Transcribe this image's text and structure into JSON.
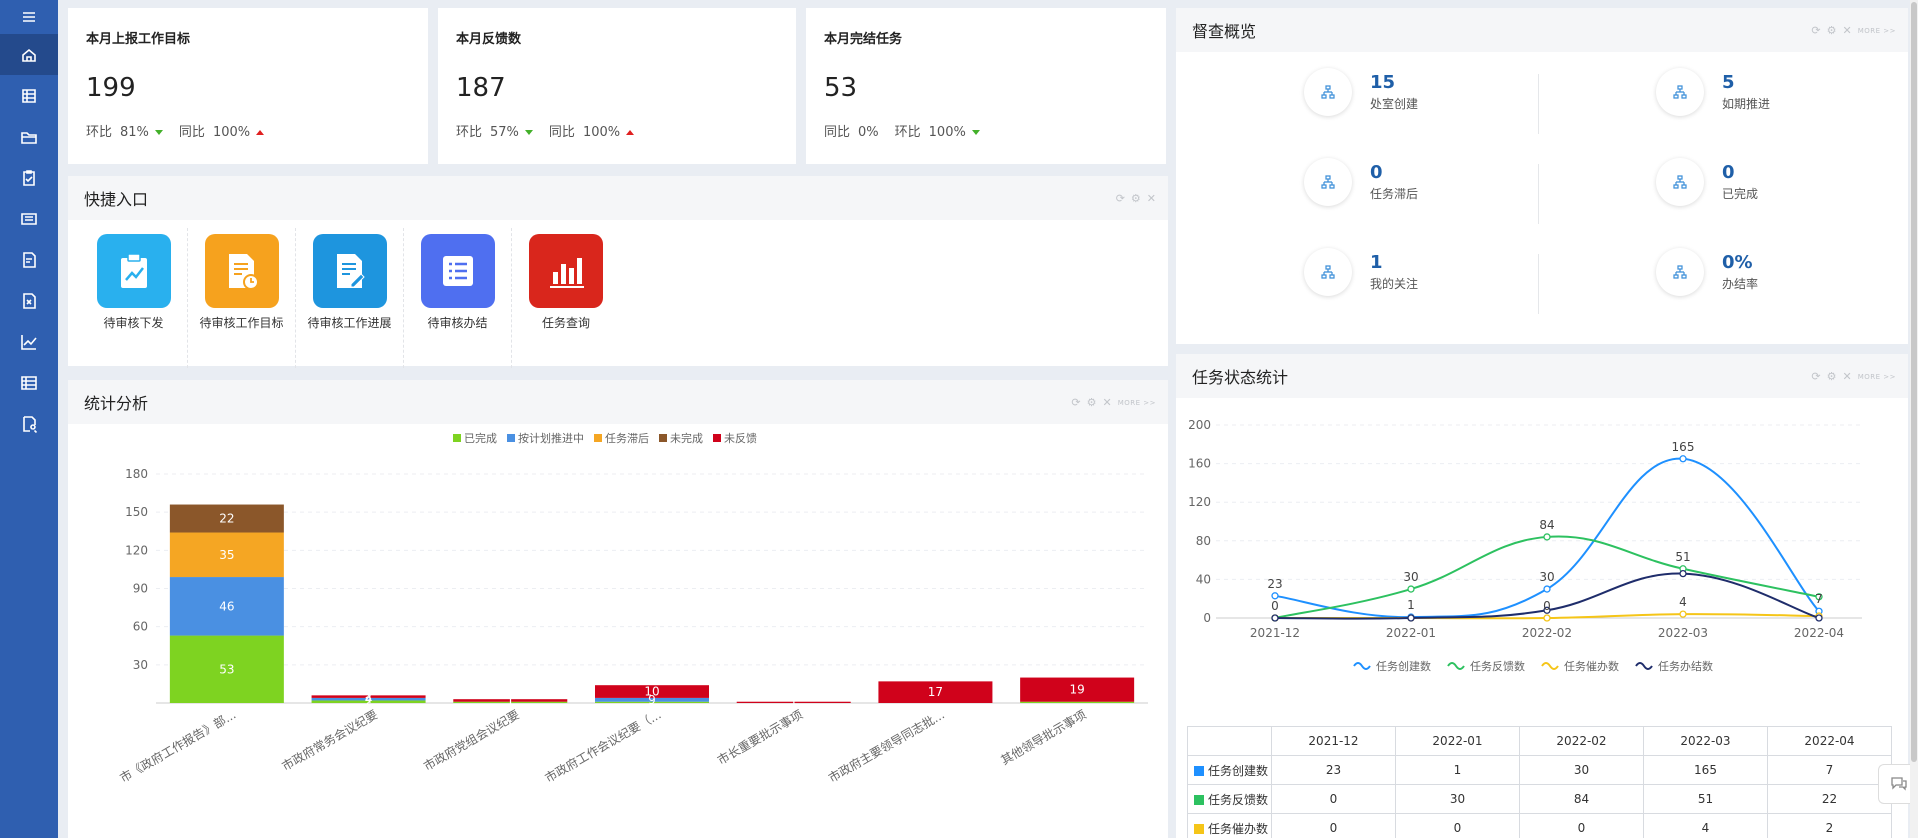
{
  "sidebar": {
    "toggle_icon": "menu-icon",
    "items": [
      {
        "icon": "home-icon",
        "active": true
      },
      {
        "icon": "table-icon"
      },
      {
        "icon": "folder-icon"
      },
      {
        "icon": "clipboard-check-icon"
      },
      {
        "icon": "list-card-icon"
      },
      {
        "icon": "document-edit-icon"
      },
      {
        "icon": "document-cancel-icon"
      },
      {
        "icon": "line-chart-icon"
      },
      {
        "icon": "grid-table-icon"
      },
      {
        "icon": "document-search-icon"
      }
    ]
  },
  "kpis": [
    {
      "title": "本月上报工作目标",
      "value": "199",
      "c1_label": "环比",
      "c1_value": "81%",
      "c1_dir": "down",
      "c2_label": "同比",
      "c2_value": "100%",
      "c2_dir": "up"
    },
    {
      "title": "本月反馈数",
      "value": "187",
      "c1_label": "环比",
      "c1_value": "57%",
      "c1_dir": "down",
      "c2_label": "同比",
      "c2_value": "100%",
      "c2_dir": "up"
    },
    {
      "title": "本月完结任务",
      "value": "53",
      "c1_label": "同比",
      "c1_value": "0%",
      "c1_dir": "none",
      "c2_label": "环比",
      "c2_value": "100%",
      "c2_dir": "down"
    }
  ],
  "quick_entry": {
    "title": "快捷入口",
    "items": [
      {
        "label": "待审核下发",
        "icon": "clipboard-chart-icon",
        "color": "#29b0ee"
      },
      {
        "label": "待审核工作目标",
        "icon": "document-clock-icon",
        "color": "#f6a21e"
      },
      {
        "label": "待审核工作进展",
        "icon": "document-pen-icon",
        "color": "#1e95de"
      },
      {
        "label": "待审核办结",
        "icon": "list-icon",
        "color": "#4f6ff0"
      },
      {
        "label": "任务查询",
        "icon": "bar-chart-icon",
        "color": "#d9261c"
      }
    ]
  },
  "tools": {
    "more": "MORE >>"
  },
  "overview": {
    "title": "督查概览",
    "items": [
      {
        "value": "15",
        "label": "处室创建"
      },
      {
        "value": "5",
        "label": "如期推进"
      },
      {
        "value": "0",
        "label": "任务滞后"
      },
      {
        "value": "0",
        "label": "已完成"
      },
      {
        "value": "1",
        "label": "我的关注"
      },
      {
        "value": "0%",
        "label": "办结率"
      }
    ]
  },
  "stats": {
    "title": "统计分析",
    "legend": [
      {
        "name": "已完成",
        "color": "#7ed321"
      },
      {
        "name": "按计划推进中",
        "color": "#4a90e2"
      },
      {
        "name": "任务滞后",
        "color": "#f5a623"
      },
      {
        "name": "未完成",
        "color": "#8b572a"
      },
      {
        "name": "未反馈",
        "color": "#d0021b"
      }
    ]
  },
  "status_stats": {
    "title": "任务状态统计",
    "table": {
      "headers": [
        "2021-12",
        "2022-01",
        "2022-02",
        "2022-03",
        "2022-04"
      ],
      "rows": [
        {
          "name": "任务创建数",
          "color": "#1e90ff",
          "values": [
            "23",
            "1",
            "30",
            "165",
            "7"
          ]
        },
        {
          "name": "任务反馈数",
          "color": "#2dc160",
          "values": [
            "0",
            "30",
            "84",
            "51",
            "22"
          ]
        },
        {
          "name": "任务催办数",
          "color": "#f5c518",
          "values": [
            "0",
            "0",
            "0",
            "4",
            "2"
          ]
        }
      ]
    }
  },
  "chart_data": [
    {
      "type": "bar",
      "stacked": true,
      "categories": [
        "市《政府工作报告》部...",
        "市政府常务会议纪要",
        "市政府党组会议纪要",
        "市政府工作会议纪要（...",
        "市长重要批示事项",
        "市政府主要领导同志批...",
        "其他领导批示事项"
      ],
      "series": [
        {
          "name": "已完成",
          "color": "#7ed321",
          "values": [
            53,
            2,
            1,
            1,
            0,
            0,
            1
          ]
        },
        {
          "name": "按计划推进中",
          "color": "#4a90e2",
          "values": [
            46,
            2,
            0,
            3,
            0,
            0,
            0
          ]
        },
        {
          "name": "任务滞后",
          "color": "#f5a623",
          "values": [
            35,
            0,
            0,
            0,
            0,
            0,
            0
          ]
        },
        {
          "name": "未完成",
          "color": "#8b572a",
          "values": [
            22,
            0,
            0,
            0,
            0,
            0,
            0
          ]
        },
        {
          "name": "未反馈",
          "color": "#d0021b",
          "values": [
            0,
            2,
            2,
            10,
            1,
            17,
            19
          ]
        }
      ],
      "data_labels": [
        {
          "cat": 0,
          "series": 0,
          "text": "53"
        },
        {
          "cat": 0,
          "series": 1,
          "text": "46"
        },
        {
          "cat": 0,
          "series": 2,
          "text": "35"
        },
        {
          "cat": 0,
          "series": 3,
          "text": "22"
        },
        {
          "cat": 1,
          "series": 0,
          "text": "2"
        },
        {
          "cat": 1,
          "series": 1,
          "text": "4"
        },
        {
          "cat": 1,
          "series": 4,
          "text": "2"
        },
        {
          "cat": 2,
          "series": 4,
          "text": "1"
        },
        {
          "cat": 3,
          "series": 1,
          "text": "9"
        },
        {
          "cat": 3,
          "series": 4,
          "text": "10"
        },
        {
          "cat": 4,
          "series": 4,
          "text": "1"
        },
        {
          "cat": 5,
          "series": 4,
          "text": "17"
        },
        {
          "cat": 6,
          "series": 4,
          "text": "19"
        }
      ],
      "ylim": [
        0,
        180
      ],
      "yticks": [
        30,
        60,
        90,
        120,
        150,
        180
      ],
      "grid": true,
      "legend": "top-center"
    },
    {
      "type": "line",
      "smooth": true,
      "x": [
        "2021-12",
        "2022-01",
        "2022-02",
        "2022-03",
        "2022-04"
      ],
      "series": [
        {
          "name": "任务创建数",
          "color": "#1e90ff",
          "values": [
            23,
            1,
            30,
            165,
            7
          ]
        },
        {
          "name": "任务反馈数",
          "color": "#2dc160",
          "values": [
            0,
            30,
            84,
            51,
            22
          ]
        },
        {
          "name": "任务催办数",
          "color": "#f5c518",
          "values": [
            0,
            0,
            0,
            4,
            2
          ]
        },
        {
          "name": "任务办结数",
          "color": "#1f2d6b",
          "values": [
            0,
            0,
            8,
            46,
            0
          ]
        }
      ],
      "point_labels": [
        {
          "x": 0,
          "y": 23,
          "text": "23"
        },
        {
          "x": 0,
          "y": 0,
          "text": "0"
        },
        {
          "x": 1,
          "y": 30,
          "text": "30"
        },
        {
          "x": 1,
          "y": 1,
          "text": "1"
        },
        {
          "x": 2,
          "y": 84,
          "text": "84"
        },
        {
          "x": 2,
          "y": 30,
          "text": "30"
        },
        {
          "x": 2,
          "y": 0,
          "text": "0"
        },
        {
          "x": 3,
          "y": 165,
          "text": "165"
        },
        {
          "x": 3,
          "y": 51,
          "text": "51"
        },
        {
          "x": 3,
          "y": 4,
          "text": "4"
        },
        {
          "x": 4,
          "y": 7,
          "text": "7"
        }
      ],
      "ylim": [
        0,
        200
      ],
      "yticks": [
        0,
        40,
        80,
        120,
        160,
        200
      ],
      "grid": true,
      "legend": "bottom-center"
    }
  ]
}
